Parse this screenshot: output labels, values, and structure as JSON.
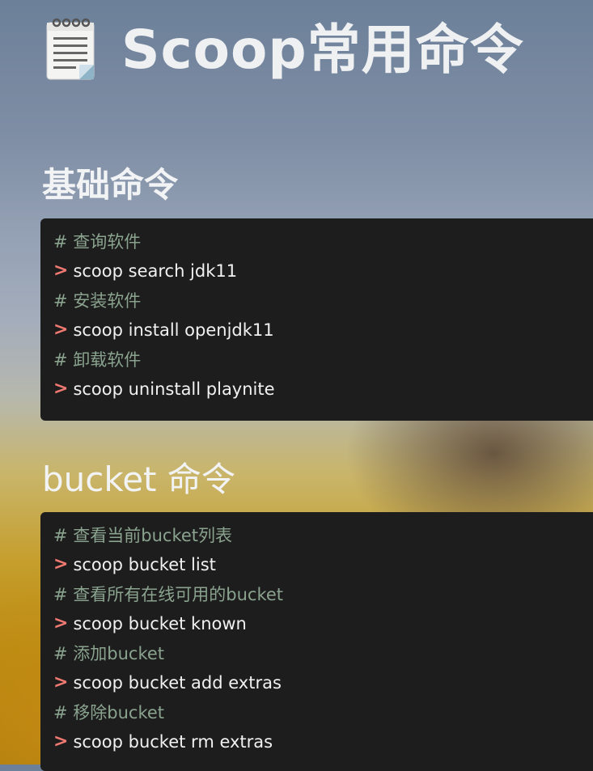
{
  "header": {
    "title": "Scoop常用命令",
    "icon": "notepad-icon"
  },
  "sections": [
    {
      "heading": "基础命令",
      "lines": [
        {
          "type": "comment",
          "text": "# 查询软件"
        },
        {
          "type": "command",
          "prompt": ">",
          "text": "scoop search jdk11"
        },
        {
          "type": "comment",
          "text": "# 安装软件"
        },
        {
          "type": "command",
          "prompt": ">",
          "text": "scoop install openjdk11"
        },
        {
          "type": "comment",
          "text": "# 卸载软件"
        },
        {
          "type": "command",
          "prompt": ">",
          "text": "scoop uninstall playnite"
        }
      ]
    },
    {
      "heading": "bucket 命令",
      "lines": [
        {
          "type": "comment",
          "text": "# 查看当前bucket列表"
        },
        {
          "type": "command",
          "prompt": ">",
          "text": "scoop bucket list"
        },
        {
          "type": "comment",
          "text": "# 查看所有在线可用的bucket"
        },
        {
          "type": "command",
          "prompt": ">",
          "text": "scoop bucket known"
        },
        {
          "type": "comment",
          "text": "# 添加bucket"
        },
        {
          "type": "command",
          "prompt": ">",
          "text": "scoop bucket add extras"
        },
        {
          "type": "comment",
          "text": "# 移除bucket"
        },
        {
          "type": "command",
          "prompt": ">",
          "text": "scoop bucket rm extras"
        }
      ]
    }
  ],
  "colors": {
    "code_bg": "#1d1d1e",
    "comment": "#8aa38e",
    "command": "#f1f1f1",
    "prompt": "#f07a72"
  }
}
